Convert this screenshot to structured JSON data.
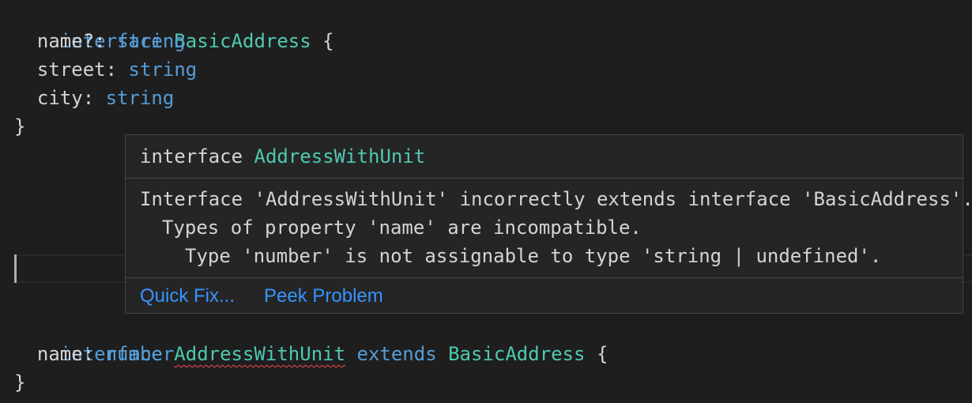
{
  "code": {
    "block1": {
      "kw_interface": "interface",
      "name": "BasicAddress",
      "open_brace": "{",
      "props": [
        {
          "name": "name?",
          "colon": ":",
          "type": "string"
        },
        {
          "name": "street",
          "colon": ":",
          "type": "string"
        },
        {
          "name": "city",
          "colon": ":",
          "type": "string"
        }
      ],
      "close_brace": "}"
    },
    "block2": {
      "kw_interface": "interface",
      "name": "AddressWithUnit",
      "kw_extends": "extends",
      "base": "BasicAddress",
      "open_brace": "{",
      "props": [
        {
          "name": "name",
          "colon": ":",
          "type": "number"
        }
      ],
      "close_brace": "}"
    }
  },
  "hover": {
    "signature_kw": "interface",
    "signature_name": "AddressWithUnit",
    "message_lines": [
      "Interface 'AddressWithUnit' incorrectly extends interface 'BasicAddress'.",
      "Types of property 'name' are incompatible.",
      "Type 'number' is not assignable to type 'string | undefined'."
    ],
    "actions": {
      "quick_fix": "Quick Fix...",
      "peek_problem": "Peek Problem"
    }
  },
  "colors": {
    "background": "#1e1e1e",
    "keyword": "#569cd6",
    "type": "#4ec9b0",
    "text": "#d4d4d4",
    "link": "#3794ff",
    "error_squiggle": "#f14c4c",
    "hover_bg": "#252526",
    "hover_border": "#454545"
  }
}
